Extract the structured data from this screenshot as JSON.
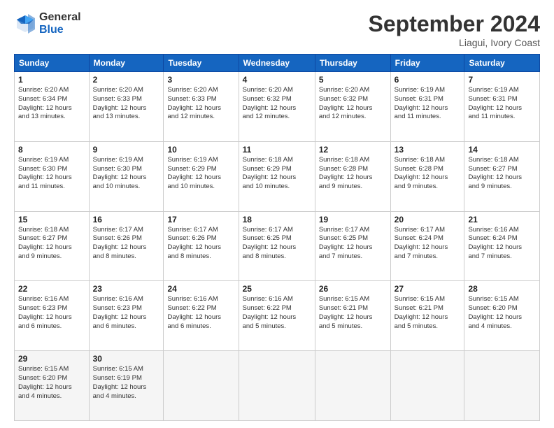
{
  "logo": {
    "general": "General",
    "blue": "Blue"
  },
  "header": {
    "month": "September 2024",
    "location": "Liagui, Ivory Coast"
  },
  "weekdays": [
    "Sunday",
    "Monday",
    "Tuesday",
    "Wednesday",
    "Thursday",
    "Friday",
    "Saturday"
  ],
  "weeks": [
    [
      {
        "day": "1",
        "info": "Sunrise: 6:20 AM\nSunset: 6:34 PM\nDaylight: 12 hours\nand 13 minutes."
      },
      {
        "day": "2",
        "info": "Sunrise: 6:20 AM\nSunset: 6:33 PM\nDaylight: 12 hours\nand 13 minutes."
      },
      {
        "day": "3",
        "info": "Sunrise: 6:20 AM\nSunset: 6:33 PM\nDaylight: 12 hours\nand 12 minutes."
      },
      {
        "day": "4",
        "info": "Sunrise: 6:20 AM\nSunset: 6:32 PM\nDaylight: 12 hours\nand 12 minutes."
      },
      {
        "day": "5",
        "info": "Sunrise: 6:20 AM\nSunset: 6:32 PM\nDaylight: 12 hours\nand 12 minutes."
      },
      {
        "day": "6",
        "info": "Sunrise: 6:19 AM\nSunset: 6:31 PM\nDaylight: 12 hours\nand 11 minutes."
      },
      {
        "day": "7",
        "info": "Sunrise: 6:19 AM\nSunset: 6:31 PM\nDaylight: 12 hours\nand 11 minutes."
      }
    ],
    [
      {
        "day": "8",
        "info": "Sunrise: 6:19 AM\nSunset: 6:30 PM\nDaylight: 12 hours\nand 11 minutes."
      },
      {
        "day": "9",
        "info": "Sunrise: 6:19 AM\nSunset: 6:30 PM\nDaylight: 12 hours\nand 10 minutes."
      },
      {
        "day": "10",
        "info": "Sunrise: 6:19 AM\nSunset: 6:29 PM\nDaylight: 12 hours\nand 10 minutes."
      },
      {
        "day": "11",
        "info": "Sunrise: 6:18 AM\nSunset: 6:29 PM\nDaylight: 12 hours\nand 10 minutes."
      },
      {
        "day": "12",
        "info": "Sunrise: 6:18 AM\nSunset: 6:28 PM\nDaylight: 12 hours\nand 9 minutes."
      },
      {
        "day": "13",
        "info": "Sunrise: 6:18 AM\nSunset: 6:28 PM\nDaylight: 12 hours\nand 9 minutes."
      },
      {
        "day": "14",
        "info": "Sunrise: 6:18 AM\nSunset: 6:27 PM\nDaylight: 12 hours\nand 9 minutes."
      }
    ],
    [
      {
        "day": "15",
        "info": "Sunrise: 6:18 AM\nSunset: 6:27 PM\nDaylight: 12 hours\nand 9 minutes."
      },
      {
        "day": "16",
        "info": "Sunrise: 6:17 AM\nSunset: 6:26 PM\nDaylight: 12 hours\nand 8 minutes."
      },
      {
        "day": "17",
        "info": "Sunrise: 6:17 AM\nSunset: 6:26 PM\nDaylight: 12 hours\nand 8 minutes."
      },
      {
        "day": "18",
        "info": "Sunrise: 6:17 AM\nSunset: 6:25 PM\nDaylight: 12 hours\nand 8 minutes."
      },
      {
        "day": "19",
        "info": "Sunrise: 6:17 AM\nSunset: 6:25 PM\nDaylight: 12 hours\nand 7 minutes."
      },
      {
        "day": "20",
        "info": "Sunrise: 6:17 AM\nSunset: 6:24 PM\nDaylight: 12 hours\nand 7 minutes."
      },
      {
        "day": "21",
        "info": "Sunrise: 6:16 AM\nSunset: 6:24 PM\nDaylight: 12 hours\nand 7 minutes."
      }
    ],
    [
      {
        "day": "22",
        "info": "Sunrise: 6:16 AM\nSunset: 6:23 PM\nDaylight: 12 hours\nand 6 minutes."
      },
      {
        "day": "23",
        "info": "Sunrise: 6:16 AM\nSunset: 6:23 PM\nDaylight: 12 hours\nand 6 minutes."
      },
      {
        "day": "24",
        "info": "Sunrise: 6:16 AM\nSunset: 6:22 PM\nDaylight: 12 hours\nand 6 minutes."
      },
      {
        "day": "25",
        "info": "Sunrise: 6:16 AM\nSunset: 6:22 PM\nDaylight: 12 hours\nand 5 minutes."
      },
      {
        "day": "26",
        "info": "Sunrise: 6:15 AM\nSunset: 6:21 PM\nDaylight: 12 hours\nand 5 minutes."
      },
      {
        "day": "27",
        "info": "Sunrise: 6:15 AM\nSunset: 6:21 PM\nDaylight: 12 hours\nand 5 minutes."
      },
      {
        "day": "28",
        "info": "Sunrise: 6:15 AM\nSunset: 6:20 PM\nDaylight: 12 hours\nand 4 minutes."
      }
    ],
    [
      {
        "day": "29",
        "info": "Sunrise: 6:15 AM\nSunset: 6:20 PM\nDaylight: 12 hours\nand 4 minutes."
      },
      {
        "day": "30",
        "info": "Sunrise: 6:15 AM\nSunset: 6:19 PM\nDaylight: 12 hours\nand 4 minutes."
      },
      {
        "day": "",
        "info": ""
      },
      {
        "day": "",
        "info": ""
      },
      {
        "day": "",
        "info": ""
      },
      {
        "day": "",
        "info": ""
      },
      {
        "day": "",
        "info": ""
      }
    ]
  ]
}
